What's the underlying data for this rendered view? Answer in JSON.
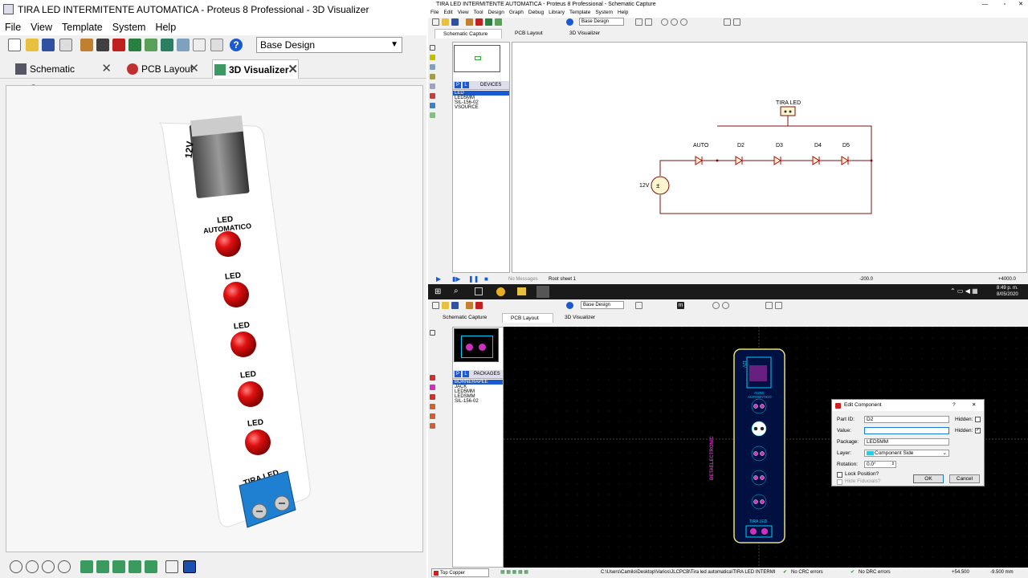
{
  "left_window": {
    "title": "TIRA LED INTERMITENTE AUTOMATICA - Proteus 8 Professional - 3D Visualizer",
    "menu": [
      "File",
      "View",
      "Template",
      "System",
      "Help"
    ],
    "design_select": "Base Design",
    "tabs": [
      {
        "label": "Schematic Capture"
      },
      {
        "label": "PCB Layout"
      },
      {
        "label": "3D Visualizer"
      }
    ],
    "board_labels": {
      "jack": "12V",
      "led1": "LED",
      "led1b": "AUTOMATICO",
      "led2": "LED",
      "led3": "LED",
      "led4": "LED",
      "led5": "LED",
      "connector": "TIRA LED"
    }
  },
  "schematic_window": {
    "title": "TIRA LED INTERMITENTE AUTOMATICA - Proteus 8 Professional - Schematic Capture",
    "menu": [
      "File",
      "Edit",
      "View",
      "Tool",
      "Design",
      "Graph",
      "Debug",
      "Library",
      "Template",
      "System",
      "Help"
    ],
    "design_select": "Base Design",
    "tabs": [
      "Schematic Capture",
      "PCB Layout",
      "3D Visualizer"
    ],
    "pane_header": "DEVICES",
    "devices": [
      "LED",
      "LED5MM",
      "SIL-156-02",
      "VSOURCE"
    ],
    "labels": {
      "tira": "TIRA LED",
      "auto": "AUTO",
      "d2": "D2",
      "d3": "D3",
      "d4": "D4",
      "d5": "D5",
      "source": "12V"
    },
    "status": {
      "messages": "No Messages",
      "sheet": "Root sheet 1",
      "x": "-200.0",
      "y": "+4000.0"
    }
  },
  "taskbar": {
    "time": "8:49 p. m.",
    "date": "8/05/2020"
  },
  "pcb_window": {
    "design_select": "Base Design",
    "tabs": [
      "Schematic Capture",
      "PCB Layout",
      "3D Visualizer"
    ],
    "pane_header": "PACKAGES",
    "packages": [
      "BORNERAPEE",
      "JACK",
      "LED5MM",
      "LEDSMM",
      "SIL-156-02"
    ],
    "status": {
      "layer": "Top Copper",
      "path": "C:\\Users\\Camilo\\Desktop\\Varios\\JLCPCB\\Tira led automatica\\TIRA LED INTERMI",
      "crc": "No CRC errors",
      "drc": "No DRC errors",
      "x": "+54.500",
      "y": "-9.500 mm"
    },
    "board_text": {
      "top": "12V",
      "auto": "AUTO",
      "autom": "AUTOMATICO",
      "brand": "BETAELECTRONIC",
      "bottom": "TIRA LED"
    }
  },
  "dialog": {
    "title": "Edit Component",
    "help": "?",
    "close": "✕",
    "part_id_label": "Part ID:",
    "part_id": "D2",
    "value_label": "Value:",
    "value": "",
    "package_label": "Package:",
    "package": "LED5MM",
    "layer_label": "Layer:",
    "layer": "Component Side",
    "rotation_label": "Rotation:",
    "rotation": "0.0°",
    "hidden_label": "Hidden:",
    "lock_label": "Lock Position?",
    "fiducials_label": "Hide Fiducials?",
    "ok": "OK",
    "cancel": "Cancel"
  },
  "colors": {
    "led_red": "#e01010",
    "jack_blue": "#1f7fd0",
    "pcb_pad": "#d030c0",
    "pcb_outline": "#f0e070",
    "schematic_wire": "#7a1010"
  }
}
